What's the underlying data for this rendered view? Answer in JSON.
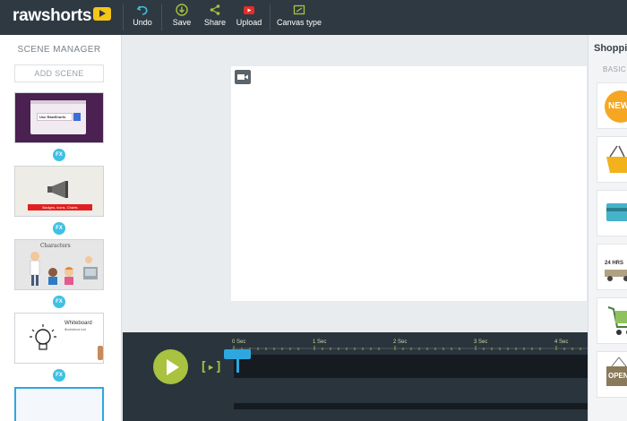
{
  "app": {
    "logo_text": "rawshorts"
  },
  "toolbar": {
    "undo": "Undo",
    "save": "Save",
    "share": "Share",
    "upload": "Upload",
    "canvas_type": "Canvas type"
  },
  "scene_manager": {
    "title": "SCENE MANAGER",
    "add_scene": "ADD SCENE",
    "fx_label": "FX",
    "scenes": [
      {
        "text": "Use RawShorts"
      },
      {
        "text": "Badges, icons, Charts"
      },
      {
        "text": "Characters"
      },
      {
        "text": "Whiteboard",
        "subtext": "illustrations tool"
      }
    ]
  },
  "timeline": {
    "step_label": "[▸]",
    "ticks": [
      "0 Sec",
      "1 Sec",
      "2 Sec",
      "3 Sec",
      "4 Sec"
    ]
  },
  "right_panel": {
    "title": "Shoppi",
    "subtitle": "BASIC",
    "assets": [
      {
        "icon": "new-badge-icon",
        "text": "NEW"
      },
      {
        "icon": "shopping-basket-icon"
      },
      {
        "icon": "credit-card-icon"
      },
      {
        "icon": "delivery-truck-icon",
        "text": "24 HRS"
      },
      {
        "icon": "shopping-cart-icon"
      },
      {
        "icon": "open-sign-icon",
        "text": "OPEN"
      }
    ]
  },
  "colors": {
    "topbar": "#2f3942",
    "accent_green": "#a9c23f",
    "accent_blue": "#2ea7e0",
    "fx_badge": "#3ec1e3",
    "logo_yellow": "#f5c518"
  }
}
